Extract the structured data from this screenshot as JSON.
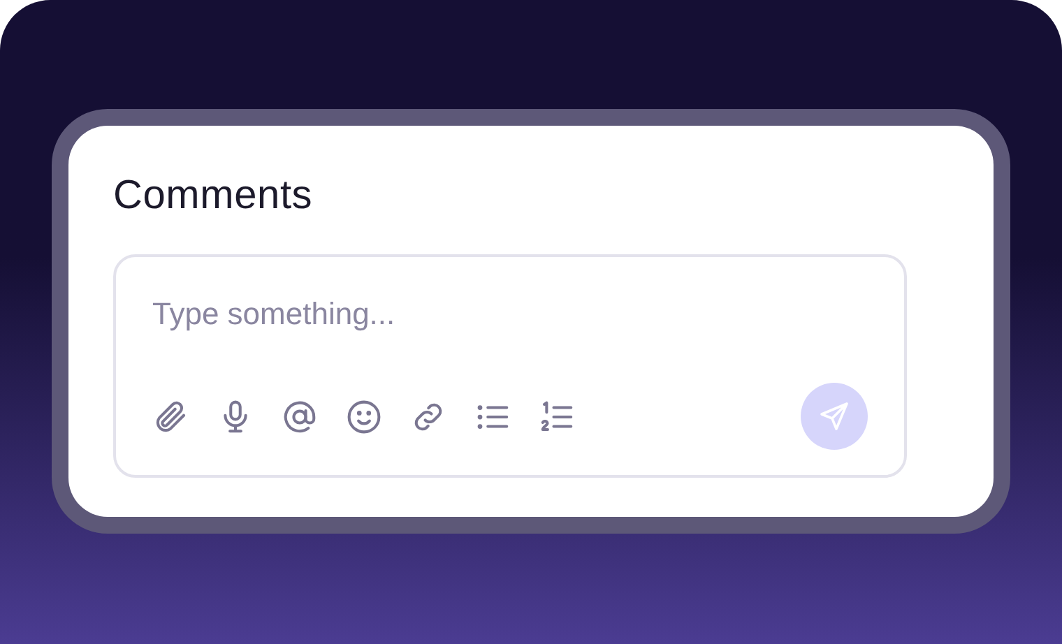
{
  "card": {
    "title": "Comments"
  },
  "comment_field": {
    "placeholder": "Type something..."
  },
  "send_button": {
    "disabled": true
  }
}
